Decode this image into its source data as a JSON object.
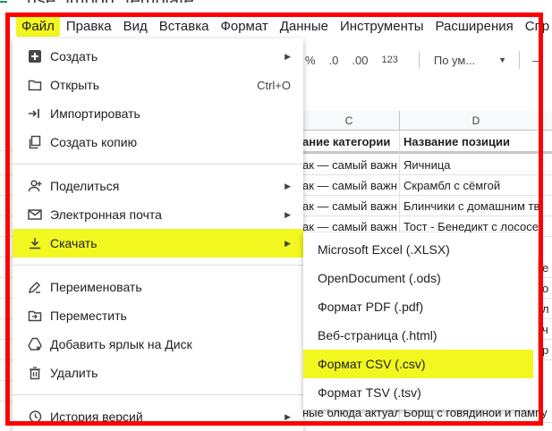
{
  "document": {
    "title": "rise_import_template"
  },
  "menubar": {
    "items": [
      "Файл",
      "Правка",
      "Вид",
      "Вставка",
      "Формат",
      "Данные",
      "Инструменты",
      "Расширения",
      "Спр"
    ]
  },
  "toolbar": {
    "percent": "%",
    "decrease_decimals": ".0",
    "increase_decimals": ".00",
    "number_format": "123",
    "font": "По ум...",
    "minus": "–"
  },
  "grid": {
    "column_headers": [
      "C",
      "D"
    ],
    "header_row": {
      "c": "ание категории",
      "d": "Название позиции"
    },
    "rows": [
      {
        "c": "ак — самый важн",
        "d": "Яичница"
      },
      {
        "c": "ак — самый важн",
        "d": "Скрамбл с сёмгой"
      },
      {
        "c": "ак — самый важн",
        "d": "Блинчики с домашним тв"
      },
      {
        "c": "ак — самый важн",
        "d": "Тост - Бенедикт с лососе"
      }
    ],
    "bottom_row": {
      "c": "ные блюда актуаль",
      "d": "Борщ с говядиной и пампу"
    },
    "edge_chars": [
      "е",
      "о",
      "л",
      "ч",
      "р"
    ]
  },
  "file_menu": {
    "items": [
      {
        "label": "Создать",
        "icon": "plus-box-icon",
        "submenu": true
      },
      {
        "label": "Открыть",
        "icon": "folder-icon",
        "shortcut": "Ctrl+O"
      },
      {
        "label": "Импортировать",
        "icon": "import-icon"
      },
      {
        "label": "Создать копию",
        "icon": "copy-icon"
      },
      {
        "label": "Поделиться",
        "icon": "person-add-icon",
        "submenu": true
      },
      {
        "label": "Электронная почта",
        "icon": "mail-icon",
        "submenu": true
      },
      {
        "label": "Скачать",
        "icon": "download-icon",
        "submenu": true,
        "highlighted": true
      },
      {
        "label": "Переименовать",
        "icon": "rename-icon"
      },
      {
        "label": "Переместить",
        "icon": "move-folder-icon"
      },
      {
        "label": "Добавить ярлык на Диск",
        "icon": "drive-shortcut-icon"
      },
      {
        "label": "Удалить",
        "icon": "trash-icon"
      },
      {
        "label": "История версий",
        "icon": "history-icon",
        "submenu": true
      }
    ]
  },
  "download_submenu": {
    "items": [
      {
        "label": "Microsoft Excel (.XLSX)"
      },
      {
        "label": "OpenDocument (.ods)"
      },
      {
        "label": "Формат PDF (.pdf)"
      },
      {
        "label": "Веб-страница (.html)"
      },
      {
        "label": "Формат CSV (.csv)",
        "highlighted": true
      },
      {
        "label": "Формат TSV (.tsv)"
      }
    ]
  },
  "colors": {
    "highlight": "#f1f71f",
    "annotation_frame": "#ff0000",
    "sheets_green": "#0f9d58"
  }
}
